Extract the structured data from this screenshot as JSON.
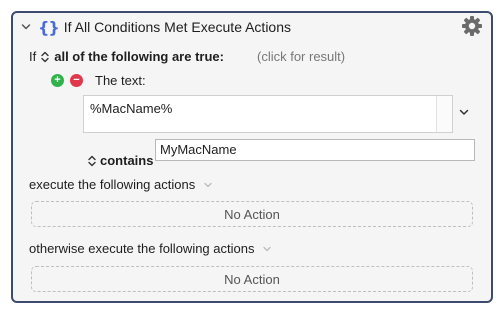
{
  "action": {
    "title": "If All Conditions Met Execute Actions",
    "if_label": "If",
    "condition_mode": "all of the following are true:",
    "result_hint": "(click for result)",
    "condition": {
      "type_label": "The text:",
      "text_value": "%MacName%",
      "operator": "contains",
      "match_value": "MyMacName"
    },
    "execute_label": "execute the following actions",
    "execute_placeholder": "No Action",
    "otherwise_label": "otherwise execute the following actions",
    "otherwise_placeholder": "No Action"
  },
  "icons": {
    "disclosure": "chevron-down-icon",
    "action": "curly-braces-icon",
    "settings": "gear-icon",
    "add": "plus-circle-icon",
    "remove": "minus-circle-icon"
  },
  "colors": {
    "border": "#3c4b6e",
    "braces": "#4a6cd4",
    "add": "#2fb34a",
    "remove": "#e0384a"
  }
}
